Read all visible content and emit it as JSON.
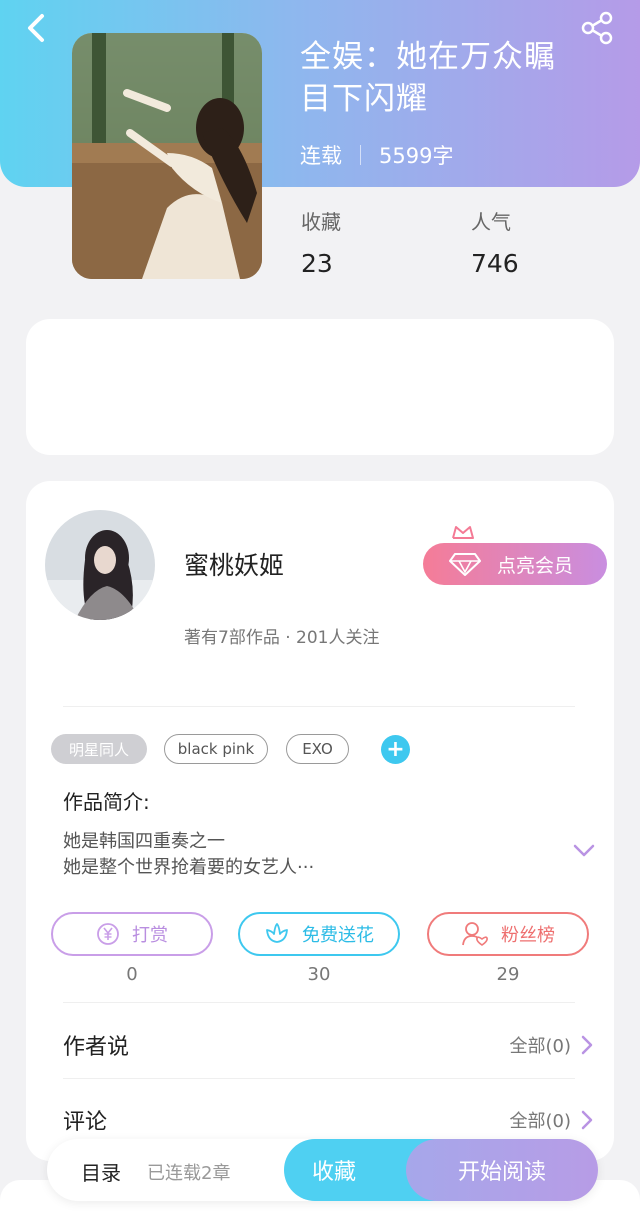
{
  "header": {
    "back_icon": "chevron-left-icon",
    "share_icon": "share-icon",
    "gradient": [
      "#5fd3f1",
      "#b59be8"
    ]
  },
  "book": {
    "title_line1": "全娱：她在万众瞩",
    "title_line2": "目下闪耀",
    "status": "连载",
    "word_count": "5599字",
    "stats": [
      {
        "label": "收藏",
        "value": "23"
      },
      {
        "label": "人气",
        "value": "746"
      }
    ]
  },
  "author": {
    "name": "蜜桃妖姬",
    "info": "著有7部作品 · 201人关注",
    "vip_label": "点亮会员"
  },
  "tags": [
    "明星同人",
    "black pink",
    "EXO"
  ],
  "intro": {
    "title": "作品简介:",
    "line1": "她是韩国四重奏之一",
    "line2": "她是整个世界抢着要的女艺人···"
  },
  "actions": [
    {
      "label": "打赏",
      "count": "0",
      "color": "#c99ee8",
      "icon": "yen-coin-icon"
    },
    {
      "label": "免费送花",
      "count": "30",
      "color": "#3ec8ef",
      "icon": "flower-icon"
    },
    {
      "label": "粉丝榜",
      "count": "29",
      "color": "#f07b7b",
      "icon": "fan-user-icon"
    }
  ],
  "sections": [
    {
      "title": "作者说",
      "more": "全部(0)"
    },
    {
      "title": "评论",
      "more": "全部(0)"
    }
  ],
  "bottom_bar": {
    "toc": "目录",
    "chapters": "已连载2章",
    "favorite": "收藏",
    "read": "开始阅读"
  }
}
